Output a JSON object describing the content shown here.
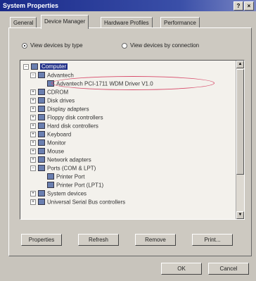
{
  "window": {
    "title": "System Properties",
    "help": "?",
    "close": "×"
  },
  "tabs": [
    {
      "label": "General"
    },
    {
      "label": "Device Manager"
    },
    {
      "label": "Hardware Profiles"
    },
    {
      "label": "Performance"
    }
  ],
  "view": {
    "by_type": "View devices by type",
    "by_connection": "View devices by connection"
  },
  "tree": [
    {
      "label": "Computer",
      "exp": "−"
    },
    {
      "label": "Advantech",
      "exp": "−"
    },
    {
      "label": "Advantech PCI-1711 WDM Driver V1.0",
      "exp": ""
    },
    {
      "label": "CDROM",
      "exp": "+"
    },
    {
      "label": "Disk drives",
      "exp": "+"
    },
    {
      "label": "Display adapters",
      "exp": "+"
    },
    {
      "label": "Floppy disk controllers",
      "exp": "+"
    },
    {
      "label": "Hard disk controllers",
      "exp": "+"
    },
    {
      "label": "Keyboard",
      "exp": "+"
    },
    {
      "label": "Monitor",
      "exp": "+"
    },
    {
      "label": "Mouse",
      "exp": "+"
    },
    {
      "label": "Network adapters",
      "exp": "+"
    },
    {
      "label": "Ports (COM & LPT)",
      "exp": "−"
    },
    {
      "label": "Printer Port",
      "exp": ""
    },
    {
      "label": "Printer Port (LPT1)",
      "exp": ""
    },
    {
      "label": "System devices",
      "exp": "+"
    },
    {
      "label": "Universal Serial Bus controllers",
      "exp": "+"
    }
  ],
  "actions": {
    "properties": "Properties",
    "refresh": "Refresh",
    "remove": "Remove",
    "print": "Print..."
  },
  "footer": {
    "ok": "OK",
    "cancel": "Cancel"
  }
}
